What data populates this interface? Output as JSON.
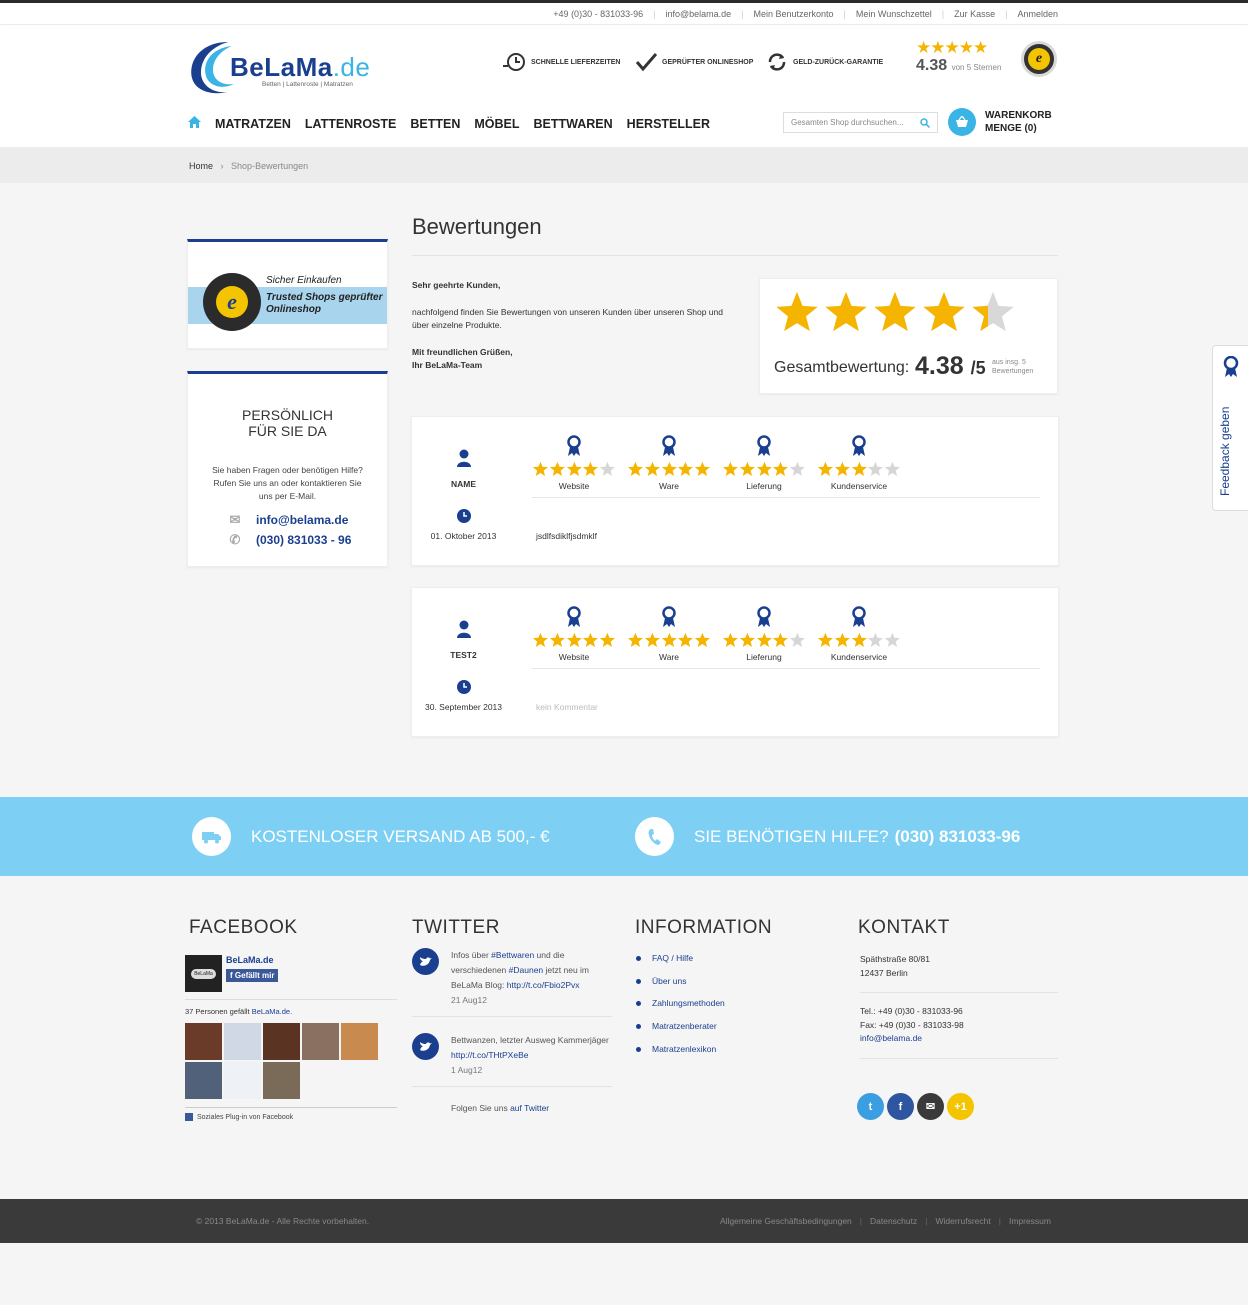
{
  "topbar": {
    "links": [
      "+49 (0)30 - 831033-96",
      "info@belama.de",
      "Mein Benutzerkonto",
      "Mein Wunschzettel",
      "Zur Kasse",
      "Anmelden"
    ]
  },
  "header": {
    "logo_word": "BeLaMa",
    "logo_tld": ".de",
    "logo_tagline": "Betten | Lattenroste | Matratzen",
    "features": [
      "SCHNELLE LIEFERZEITEN",
      "GEPRÜFTER ONLINESHOP",
      "GELD-ZURÜCK-GARANTIE"
    ],
    "rating_value": "4.38",
    "rating_suffix": "von 5 Sternen",
    "rating_fraction": 0.876
  },
  "nav": {
    "items": [
      "MATRATZEN",
      "LATTENROSTE",
      "BETTEN",
      "MÖBEL",
      "BETTWAREN",
      "HERSTELLER"
    ]
  },
  "search": {
    "placeholder": "Gesamten Shop durchsuchen..."
  },
  "cart": {
    "label": "WARENKORB",
    "count": "MENGE (0)"
  },
  "breadcrumb": {
    "home": "Home",
    "separator": "›",
    "current": "Shop-Bewertungen"
  },
  "sidebar": {
    "trusted": {
      "line1": "Sicher Einkaufen",
      "line2": "Trusted Shops geprüfter Onlineshop"
    },
    "help": {
      "title": "PERSÖNLICH FÜR SIE DA",
      "text": "Sie haben Fragen oder benötigen Hilfe? Rufen Sie uns an oder kontaktieren Sie uns per E-Mail.",
      "email": "info@belama.de",
      "phone": "(030) 831033 - 96"
    }
  },
  "main": {
    "title": "Bewertungen",
    "greeting": "Sehr geehrte Kunden,",
    "intro": "nachfolgend finden Sie Bewertungen von unseren Kunden über unseren Shop und über einzelne Produkte.",
    "closing1": "Mit freundlichen Grüßen,",
    "closing2": "Ihr BeLaMa-Team",
    "overall": {
      "label": "Gesamtbewertung:",
      "value": "4.38",
      "per": "/5",
      "count_text": "aus insg. 5 Bewertungen",
      "stars_value": 4.38
    }
  },
  "reviews": [
    {
      "name": "NAME",
      "date": "01. Oktober 2013",
      "comment": "jsdlfsdiklfjsdmklf",
      "comment_empty": false,
      "ratings": [
        {
          "label": "Website",
          "stars": 4
        },
        {
          "label": "Ware",
          "stars": 5
        },
        {
          "label": "Lieferung",
          "stars": 4
        },
        {
          "label": "Kundenservice",
          "stars": 3
        }
      ]
    },
    {
      "name": "TEST2",
      "date": "30. September 2013",
      "comment": "kein Kommentar",
      "comment_empty": true,
      "ratings": [
        {
          "label": "Website",
          "stars": 5
        },
        {
          "label": "Ware",
          "stars": 5
        },
        {
          "label": "Lieferung",
          "stars": 4
        },
        {
          "label": "Kundenservice",
          "stars": 3
        }
      ]
    }
  ],
  "band": {
    "shipping": "KOSTENLOSER VERSAND AB 500,- €",
    "help_label": "SIE BENÖTIGEN HILFE?",
    "help_phone": "(030) 831033-96"
  },
  "footer": {
    "facebook": {
      "title": "FACEBOOK",
      "page_name": "BeLaMa.de",
      "like_label": "Gefällt mir",
      "count_prefix": "37 Personen gefällt",
      "count_link": "BeLaMa.de.",
      "plugin_label": "Soziales Plug-in von Facebook",
      "faces": [
        "#6b3b2a",
        "#cfd8e4",
        "#5a3322",
        "#8a7060",
        "#c98a50",
        "#51617a",
        "#eef2f6",
        "#7a6a58"
      ]
    },
    "twitter": {
      "title": "TWITTER",
      "tweets": [
        {
          "t1": "Infos über ",
          "h1": "#Bettwaren",
          "t2": " und die verschiedenen ",
          "h2": "#Daunen",
          "t3": " jetzt neu im BeLaMa Blog: ",
          "link": "http://t.co/Fbio2Pvx",
          "when": "21 Aug12"
        },
        {
          "t1": "Bettwanzen, letzter Ausweg Kammerjäger ",
          "link": "http://t.co/THtPXeBe",
          "when": "1 Aug12"
        }
      ],
      "follow_text": "Folgen Sie uns",
      "follow_link": "auf Twitter"
    },
    "information": {
      "title": "INFORMATION",
      "items": [
        "FAQ / Hilfe",
        "Über uns",
        "Zahlungsmethoden",
        "Matratzenberater",
        "Matratzenlexikon"
      ]
    },
    "kontakt": {
      "title": "KONTAKT",
      "street": "Späthstraße 80/81",
      "city": "12437 Berlin",
      "tel": "Tel.: +49 (0)30 - 831033-96",
      "fax": "Fax: +49 (0)30 - 831033-98",
      "email": "info@belama.de"
    },
    "social": [
      {
        "name": "twitter",
        "color": "#3a9ee0",
        "glyph": "t"
      },
      {
        "name": "facebook",
        "color": "#2d55a0",
        "glyph": "f"
      },
      {
        "name": "mail",
        "color": "#3a3a3a",
        "glyph": "✉"
      },
      {
        "name": "google-plus",
        "color": "#f5c400",
        "glyph": "+1"
      }
    ],
    "copyright": "© 2013 BeLaMa.de - Alle Rechte vorbehalten.",
    "links": [
      "Allgemeine Geschäftsbedingungen",
      "Datenschutz",
      "Widerrufsrecht",
      "Impressum"
    ]
  },
  "feedback_tab": {
    "label": "Feedback geben"
  },
  "colors": {
    "brand_blue": "#1a3f8f",
    "accent": "#3ab3e5",
    "star": "#f5b400",
    "band": "#7dd0f3"
  }
}
